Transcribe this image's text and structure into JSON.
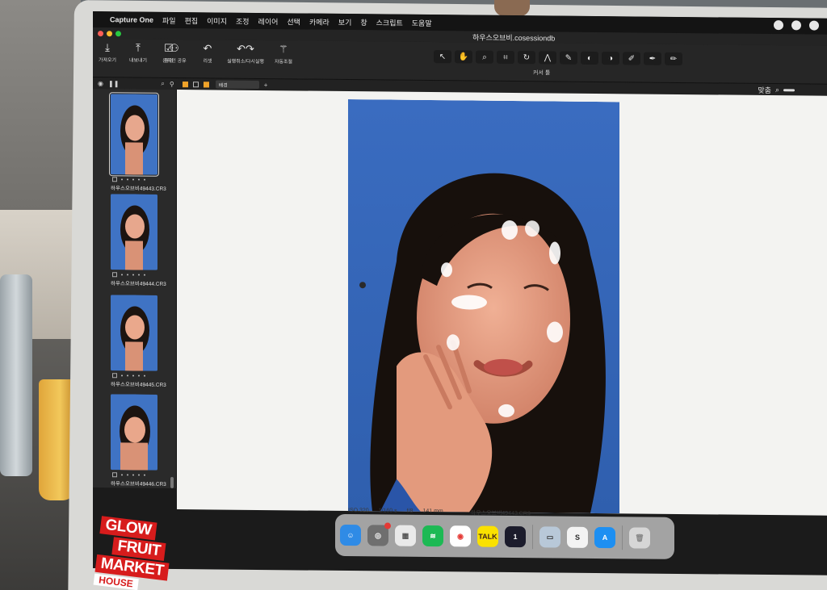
{
  "menubar": {
    "app_name": "Capture One",
    "items": [
      "파일",
      "편집",
      "이미지",
      "조정",
      "레이어",
      "선택",
      "카메라",
      "보기",
      "창",
      "스크립트",
      "도움말"
    ]
  },
  "window": {
    "title": "하우스오브비.cosessiondb"
  },
  "toolbar": {
    "buttons": [
      {
        "label": "가져오기",
        "icon": "import-icon"
      },
      {
        "label": "내보내기",
        "icon": "export-icon"
      },
      {
        "label": "점검",
        "icon": "checklist-icon"
      },
      {
        "label": "온라인 공유",
        "icon": "people-icon"
      },
      {
        "label": "리셋",
        "icon": "reset-icon"
      },
      {
        "label": "실행취소/다시실행",
        "icon": "undo-redo-icon"
      },
      {
        "label": "자동조절",
        "icon": "magic-wand-icon"
      }
    ],
    "cursor_tools_label": "커서 툴"
  },
  "subbar": {
    "sort_value": "배경",
    "zoom_fit": "맞춤"
  },
  "browser": {
    "thumbs": [
      {
        "filename": "하우스오브비49443.CR3",
        "selected": true
      },
      {
        "filename": "하우스오브비49444.CR3",
        "selected": false
      },
      {
        "filename": "하우스오브비49445.CR3",
        "selected": false
      },
      {
        "filename": "하우스오브비49446.CR3",
        "selected": false
      }
    ]
  },
  "viewer": {
    "exif": {
      "iso": "ISO 320",
      "shutter": "1/160 s",
      "aperture": "f/8",
      "focal": "141 mm",
      "filename": "하우스오브비49443.CR3"
    }
  },
  "dock": {
    "apps": [
      {
        "name": "finder-app",
        "label": "",
        "color": "#2f8be6"
      },
      {
        "name": "photos-app",
        "label": "",
        "color": "#7a7a7a"
      },
      {
        "name": "launchpad-app",
        "label": "",
        "color": "#e9e9e9"
      },
      {
        "name": "spotify-app",
        "label": "",
        "color": "#1db954"
      },
      {
        "name": "chrome-app",
        "label": "",
        "color": "#f5c518"
      },
      {
        "name": "kakaotalk-app",
        "label": "TALK",
        "color": "#fae100"
      },
      {
        "name": "one-app",
        "label": "1",
        "color": "#2a2a2a"
      },
      {
        "name": "preview-app",
        "label": "",
        "color": "#b8c8d8"
      },
      {
        "name": "script-app",
        "label": "S",
        "color": "#f1f1f1"
      },
      {
        "name": "app-store-app",
        "label": "A",
        "color": "#1d8ff2"
      },
      {
        "name": "trash-app",
        "label": "",
        "color": "#cfcfcf"
      }
    ]
  },
  "sticker": {
    "lines": [
      "GLOW",
      "FRUIT",
      "MARKET"
    ],
    "sub": "HOUSE"
  },
  "colors": {
    "accent": "#f0a32a",
    "sky": "#3c6fc0"
  }
}
